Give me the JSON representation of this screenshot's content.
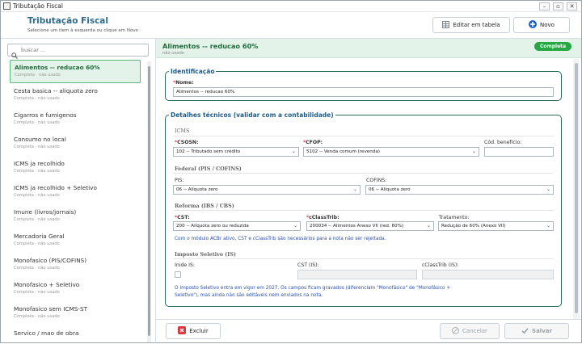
{
  "window": {
    "title": "Tributação Fiscal"
  },
  "header": {
    "title": "Tributação Fiscal",
    "subtitle": "Selecione um item à esquerda ou clique em Novo",
    "edit_table_label": "Editar em tabela",
    "new_label": "Novo"
  },
  "search": {
    "placeholder": "buscar ..."
  },
  "sidebar": {
    "items": [
      {
        "name": "Alimentos -- reducao 60%",
        "status": "Completa · não usado"
      },
      {
        "name": "Cesta basica -- aliquota zero",
        "status": "Completa · não usado"
      },
      {
        "name": "Cigarros e fumigenos",
        "status": "Completa · não usado"
      },
      {
        "name": "Consumo no local",
        "status": "Completa · não usado"
      },
      {
        "name": "ICMS ja recolhido",
        "status": "Completa · não usado"
      },
      {
        "name": "ICMS ja recolhido + Seletivo",
        "status": "Completa · não usado"
      },
      {
        "name": "Imune (livros/jornais)",
        "status": "Completa · não usado"
      },
      {
        "name": "Mercadoria Geral",
        "status": "Completa · não usado"
      },
      {
        "name": "Monofasico (PIS/COFINS)",
        "status": "Completa · não usado"
      },
      {
        "name": "Monofasico + Seletivo",
        "status": "Completa · não usado"
      },
      {
        "name": "Monofasico sem ICMS-ST",
        "status": "Completa · não usado"
      },
      {
        "name": "Servico / mao de obra",
        "status": ""
      }
    ]
  },
  "detail": {
    "title": "Alimentos -- reducao 60%",
    "subtitle": "não usado",
    "badge": "Completa"
  },
  "identificacao": {
    "legend": "Identificação",
    "nome_label": "Nome:",
    "nome_value": "Alimentos -- reducao 60%"
  },
  "detalhes": {
    "legend": "Detalhes técnicos (validar com a contabilidade)",
    "icms": {
      "section": "ICMS",
      "csosn_label": "CSOSN:",
      "csosn_value": "102 -- Tributado sem crédito",
      "cfop_label": "CFOP:",
      "cfop_value": "5102 -- Venda comum (revenda)",
      "cod_label": "Cód. benefício:",
      "cod_value": ""
    },
    "federal": {
      "section": "Federal (PIS / COFINS)",
      "pis_label": "PIS:",
      "pis_value": "06 -- Alíquota zero",
      "cofins_label": "COFINS:",
      "cofins_value": "06 -- Alíquota zero"
    },
    "reforma": {
      "section": "Reforma (IBS / CBS)",
      "cst_label": "CST:",
      "cst_value": "200 -- Alíquota zero ou reduzida",
      "cclass_label": "cClassTrib:",
      "cclass_value": "200034 -- Alimentos Anexo VII (red. 60%)",
      "trat_label": "Tratamento:",
      "trat_value": "Redução de 60% (Anexo VII)",
      "note": "Com o módulo ACBr ativo, CST e cClassTrib são necessários para a nota não ser rejeitada."
    },
    "seletivo": {
      "section": "Imposto Seletivo (IS)",
      "inide_label": "Inide IS:",
      "cst_label": "CST (IS):",
      "cst_value": "",
      "cclass_label": "cClassTrib (IS):",
      "cclass_value": "",
      "note_line1": "O Imposto Seletivo entra em vigor em 2027. Os campos ficam gravados (diferenciam \"Monofásico\" de \"Monofásico +",
      "note_line2": "Seletivo\"), mas ainda não são editáveis nem enviados na nota."
    }
  },
  "footer": {
    "delete_label": "Excluir",
    "cancel_label": "Cancelar",
    "save_label": "Salvar"
  },
  "colors": {
    "accent_green": "#28a745",
    "selected_bg": "#e4f3ea",
    "group_border": "#2a6b5a",
    "title_blue": "#2d6b8a",
    "delete_red": "#d9363e",
    "new_blue": "#1e63c6"
  }
}
